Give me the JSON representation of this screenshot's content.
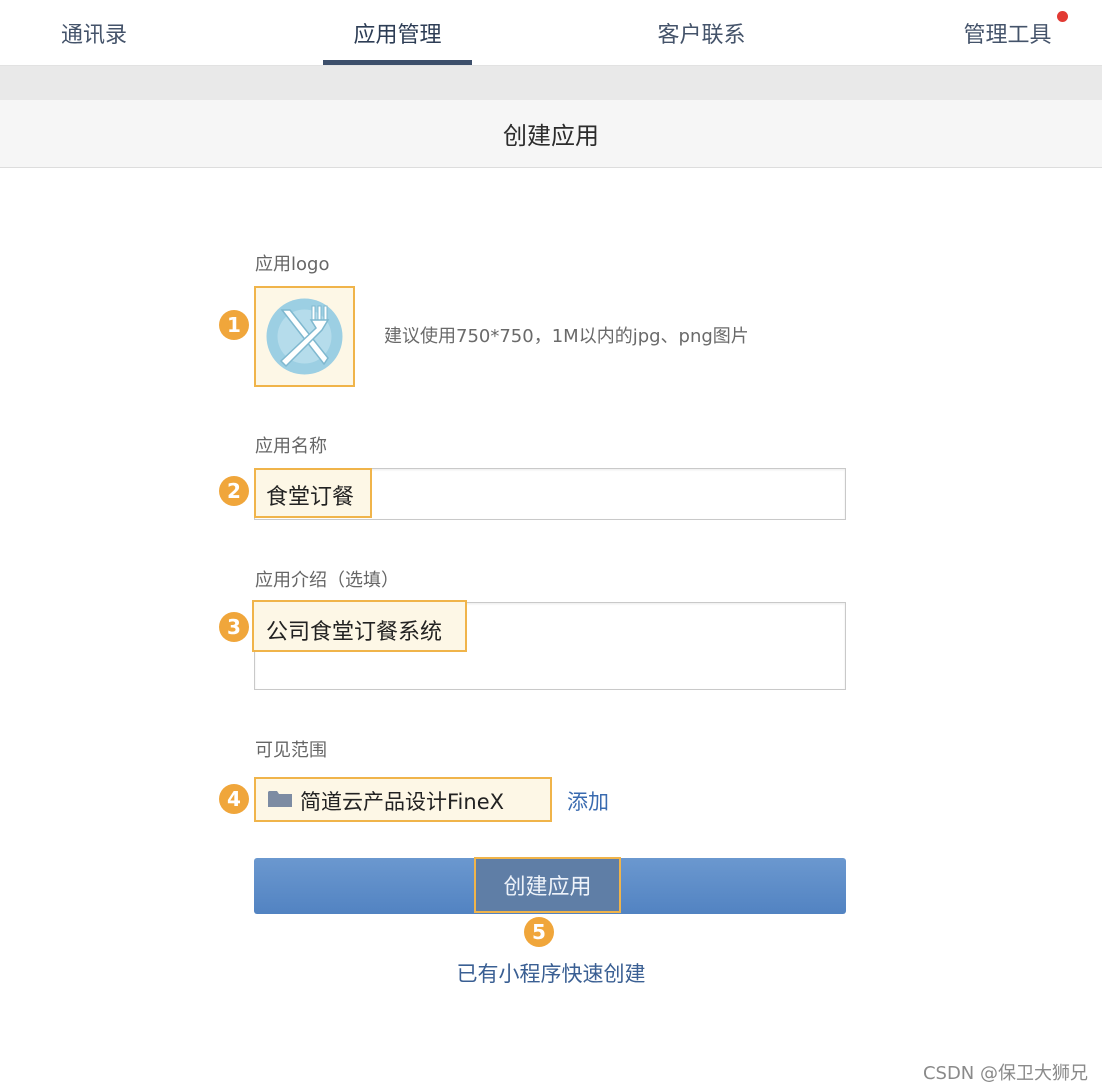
{
  "nav": {
    "tabs": [
      {
        "label": "通讯录"
      },
      {
        "label": "应用管理"
      },
      {
        "label": "客户联系"
      },
      {
        "label": "管理工具"
      }
    ],
    "notification_color": "#e23a33"
  },
  "header": {
    "title": "创建应用"
  },
  "form": {
    "logo": {
      "label": "应用logo",
      "icon": "plate-fork-knife-icon",
      "tip": "建议使用750*750，1M以内的jpg、png图片"
    },
    "name": {
      "label": "应用名称",
      "value": "食堂订餐"
    },
    "intro": {
      "label": "应用介绍（选填）",
      "value": "公司食堂订餐系统"
    },
    "visibility": {
      "label": "可见范围",
      "icon": "folder-icon",
      "selected": "简道云产品设计FineX",
      "add_label": "添加"
    }
  },
  "actions": {
    "create_label": "创建应用",
    "quick_create_label": "已有小程序快速创建"
  },
  "markers": [
    "1",
    "2",
    "3",
    "4",
    "5"
  ],
  "colors": {
    "accent": "#5a8bc9",
    "highlight": "#f0b44a",
    "marker": "#f0a63b",
    "link": "#3a6bb0"
  },
  "watermark": "CSDN @保卫大狮兄"
}
